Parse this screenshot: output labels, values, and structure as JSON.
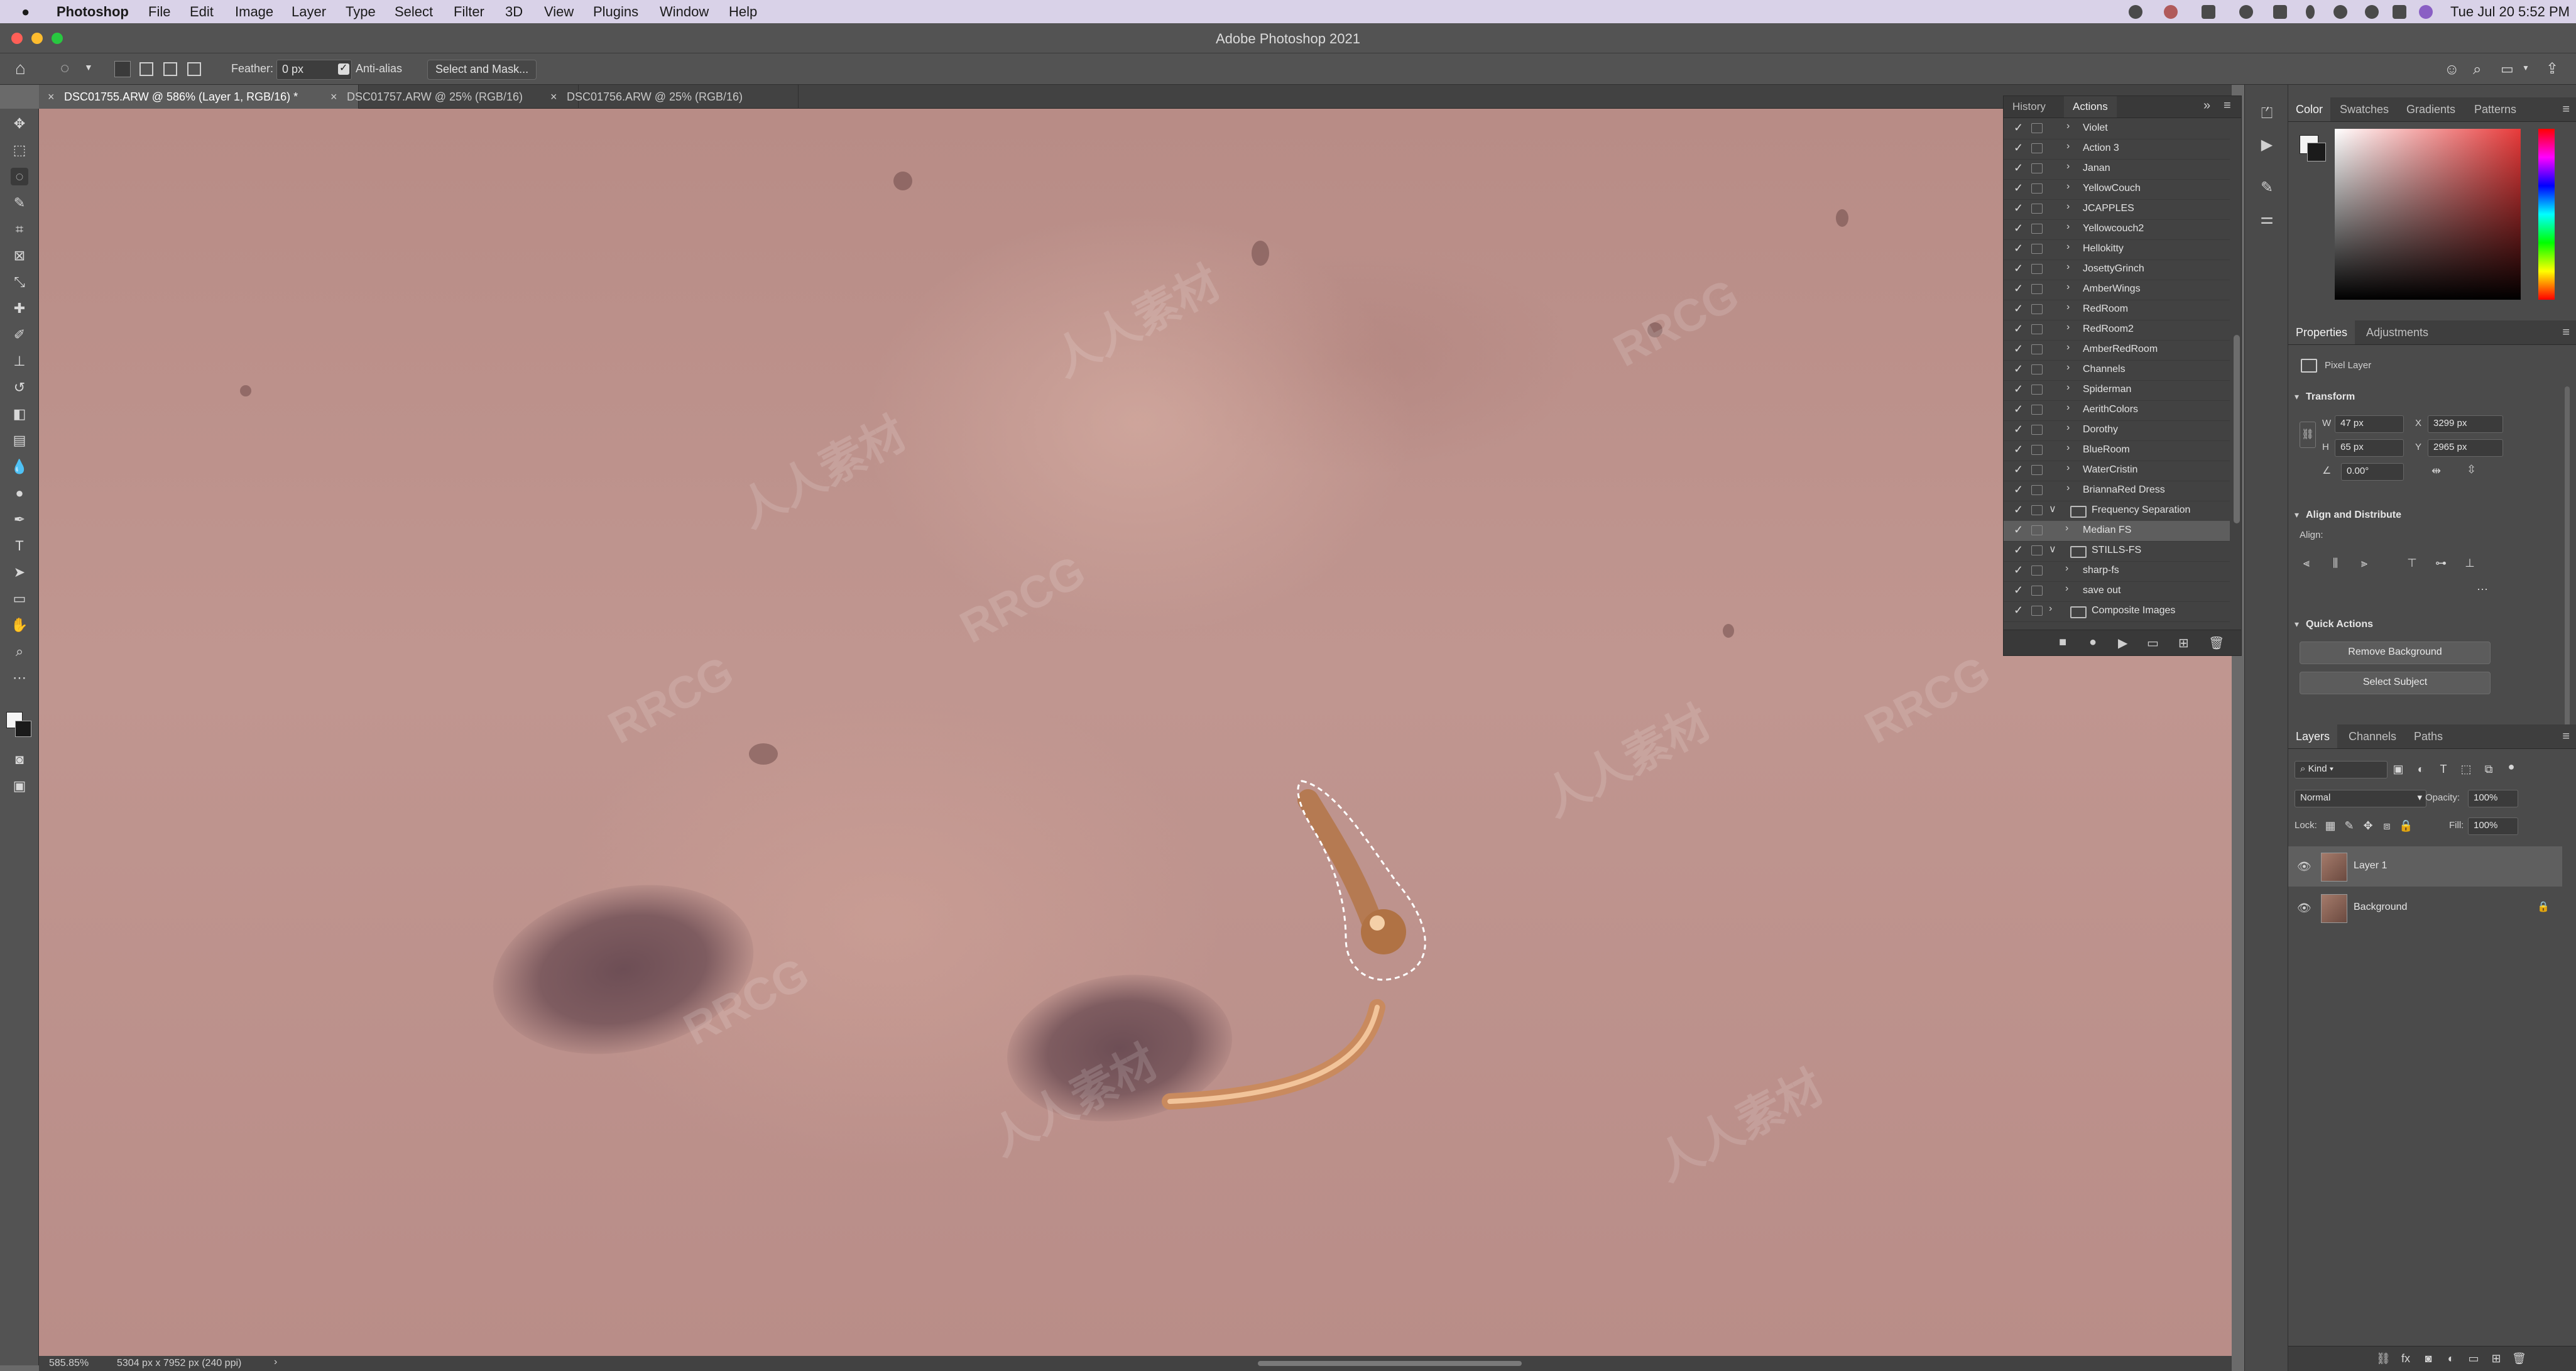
{
  "menubar": {
    "apple": "",
    "app": "Photoshop",
    "items": [
      "File",
      "Edit",
      "Image",
      "Layer",
      "Type",
      "Select",
      "Filter",
      "3D",
      "View",
      "Plugins",
      "Window",
      "Help"
    ],
    "clock": "Tue Jul 20  5:52 PM"
  },
  "window": {
    "title": "Adobe Photoshop 2021"
  },
  "options": {
    "feather_label": "Feather:",
    "feather_value": "0 px",
    "antialias_label": "Anti-alias",
    "select_mask_label": "Select and Mask..."
  },
  "doc_tabs": [
    {
      "label": "DSC01755.ARW @ 586% (Layer 1, RGB/16) *"
    },
    {
      "label": "DSC01757.ARW @ 25% (RGB/16)"
    },
    {
      "label": "DSC01756.ARW @ 25% (RGB/16)"
    }
  ],
  "status": {
    "zoom": "585.85%",
    "doc_size": "5304 px x 7952 px (240 ppi)",
    "arrow": "›"
  },
  "actions_panel": {
    "tabs": [
      "History",
      "Actions"
    ],
    "rows": [
      "Violet",
      "Action 3",
      "Janan",
      "YellowCouch",
      "JCAPPLES",
      "Yellowcouch2",
      "Hellokitty",
      "JosettyGrinch",
      "AmberWings",
      "RedRoom",
      "RedRoom2",
      "AmberRedRoom",
      "Channels",
      "Spiderman",
      "AerithColors",
      "Dorothy",
      "BlueRoom",
      "WaterCristin",
      "BriannaRed Dress",
      "Frequency Separation",
      "Median FS",
      "STILLS-FS",
      "sharp-fs",
      "save out",
      "Composite Images"
    ],
    "selected_index": 20
  },
  "color_panel": {
    "tabs": [
      "Color",
      "Swatches",
      "Gradients",
      "Patterns"
    ],
    "accent": "#e83a3a"
  },
  "properties_panel": {
    "tabs": [
      "Properties",
      "Adjustments"
    ],
    "layer_type": "Pixel Layer",
    "transform_head": "Transform",
    "w_label": "W",
    "w_value": "47 px",
    "h_label": "H",
    "h_value": "65 px",
    "x_label": "X",
    "x_value": "3299 px",
    "y_label": "Y",
    "y_value": "2965 px",
    "angle_value": "0.00°",
    "align_head": "Align and Distribute",
    "align_label": "Align:",
    "quick_head": "Quick Actions",
    "remove_bg": "Remove Background",
    "select_subject": "Select Subject"
  },
  "layers_panel": {
    "tabs": [
      "Layers",
      "Channels",
      "Paths"
    ],
    "kind": "Kind",
    "blend_mode": "Normal",
    "opacity_label": "Opacity:",
    "opacity_value": "100%",
    "lock_label": "Lock:",
    "fill_label": "Fill:",
    "fill_value": "100%",
    "layers": [
      {
        "name": "Layer 1",
        "selected": true
      },
      {
        "name": "Background",
        "selected": false
      }
    ],
    "footer_fx": "fx"
  },
  "watermarks": [
    "RRCG",
    "人人素材"
  ]
}
